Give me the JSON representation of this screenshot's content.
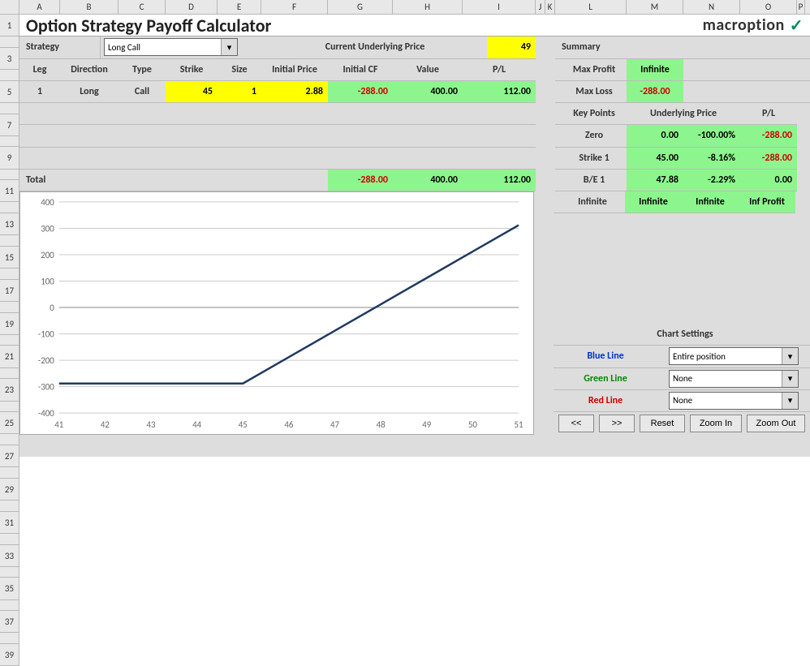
{
  "title": "Option Strategy Payoff Calculator",
  "brand": "macroption",
  "strategy_label": "Strategy",
  "strategy_value": "Long Call",
  "cup_label": "Current Underlying Price",
  "cup_value": "49",
  "leg_headers": {
    "leg": "Leg",
    "dir": "Direction",
    "type": "Type",
    "strike": "Strike",
    "size": "Size",
    "iprice": "Initial Price",
    "icf": "Initial CF",
    "value": "Value",
    "pl": "P/L"
  },
  "leg1": {
    "leg": "1",
    "dir": "Long",
    "type": "Call",
    "strike": "45",
    "size": "1",
    "iprice": "2.88",
    "icf": "-288.00",
    "value": "400.00",
    "pl": "112.00"
  },
  "total_label": "Total",
  "totals": {
    "icf": "-288.00",
    "value": "400.00",
    "pl": "112.00"
  },
  "summary": {
    "header": "Summary",
    "max_profit_label": "Max Profit",
    "max_profit": "Infinite",
    "max_loss_label": "Max Loss",
    "max_loss": "-288.00",
    "key_points_label": "Key Points",
    "up_label": "Underlying Price",
    "pl_label": "P/L",
    "rows": [
      {
        "name": "Zero",
        "c1": "0.00",
        "c2": "-100.00%",
        "c3": "-288.00",
        "neg": true
      },
      {
        "name": "Strike 1",
        "c1": "45.00",
        "c2": "-8.16%",
        "c3": "-288.00",
        "neg": true
      },
      {
        "name": "B/E 1",
        "c1": "47.88",
        "c2": "-2.29%",
        "c3": "0.00",
        "neg": false
      },
      {
        "name": "Infinite",
        "c1": "Infinite",
        "c2": "Infinite",
        "c3": "Inf Profit",
        "neg": false,
        "center": true
      }
    ]
  },
  "chart_settings": {
    "header": "Chart Settings",
    "blue_label": "Blue Line",
    "blue_value": "Entire position",
    "green_label": "Green Line",
    "green_value": "None",
    "red_label": "Red Line",
    "red_value": "None"
  },
  "buttons": {
    "prev": "<<",
    "next": ">>",
    "reset": "Reset",
    "zoom_in": "Zoom In",
    "zoom_out": "Zoom Out"
  },
  "chart_data": {
    "type": "line",
    "title": "",
    "xlabel": "",
    "ylabel": "",
    "x": [
      41,
      42,
      43,
      44,
      45,
      46,
      47,
      48,
      49,
      50,
      51
    ],
    "series": [
      {
        "name": "Entire position",
        "values": [
          -288,
          -288,
          -288,
          -288,
          -288,
          -188,
          -88,
          12,
          112,
          212,
          312
        ]
      }
    ],
    "xlim": [
      41,
      51
    ],
    "ylim": [
      -400,
      400
    ],
    "xticks": [
      41,
      42,
      43,
      44,
      45,
      46,
      47,
      48,
      49,
      50,
      51
    ],
    "yticks": [
      -400,
      -300,
      -200,
      -100,
      0,
      100,
      200,
      300,
      400
    ]
  },
  "columns": [
    "A",
    "B",
    "C",
    "D",
    "E",
    "F",
    "G",
    "H",
    "I",
    "J",
    "K",
    "L",
    "M",
    "N",
    "O",
    "P"
  ]
}
